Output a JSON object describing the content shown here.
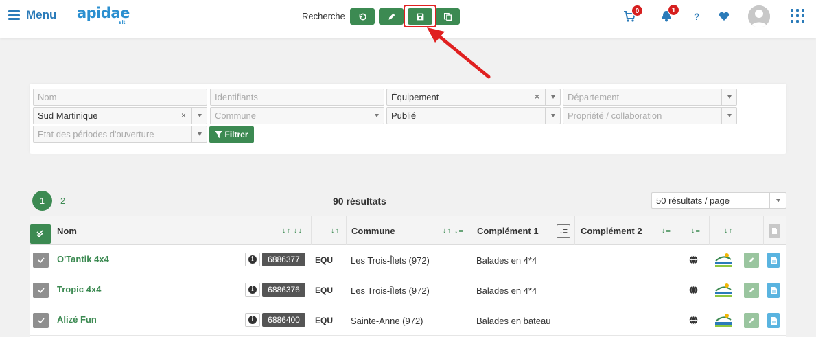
{
  "header": {
    "menu_label": "Menu",
    "logo_text": "apidae",
    "logo_sub": "sit",
    "search_label": "Recherche",
    "cart_count": "0",
    "notif_count": "1",
    "help_label": "?"
  },
  "filters": {
    "nom_placeholder": "Nom",
    "identifiants_placeholder": "Identifiants",
    "type_value": "Équipement",
    "departement_placeholder": "Département",
    "territoire_value": "Sud Martinique",
    "commune_placeholder": "Commune",
    "statut_value": "Publié",
    "propriete_placeholder": "Propriété / collaboration",
    "periodes_placeholder": "Etat des périodes d'ouverture",
    "filter_button": "Filtrer",
    "clear_glyph": "×"
  },
  "pagination": {
    "page1": "1",
    "page2": "2",
    "results": "90 résultats",
    "per_page": "50 résultats / page"
  },
  "table": {
    "columns": {
      "nom": "Nom",
      "commune": "Commune",
      "complement1": "Complément 1",
      "complement2": "Complément 2"
    },
    "rows": [
      {
        "name": "O'Tantik 4x4",
        "id": "6886377",
        "type": "EQU",
        "commune": "Les Trois-Îlets (972)",
        "complement1": "Balades en 4*4"
      },
      {
        "name": "Tropic 4x4",
        "id": "6886376",
        "type": "EQU",
        "commune": "Les Trois-Îlets (972)",
        "complement1": "Balades en 4*4"
      },
      {
        "name": "Alizé Fun",
        "id": "6886400",
        "type": "EQU",
        "commune": "Sainte-Anne (972)",
        "complement1": "Balades en bateau"
      }
    ]
  },
  "colors": {
    "primary_green": "#3c8a52",
    "brand_blue": "#2b7bb9",
    "badge_red": "#d61f1f",
    "highlight_red": "#e02020"
  }
}
